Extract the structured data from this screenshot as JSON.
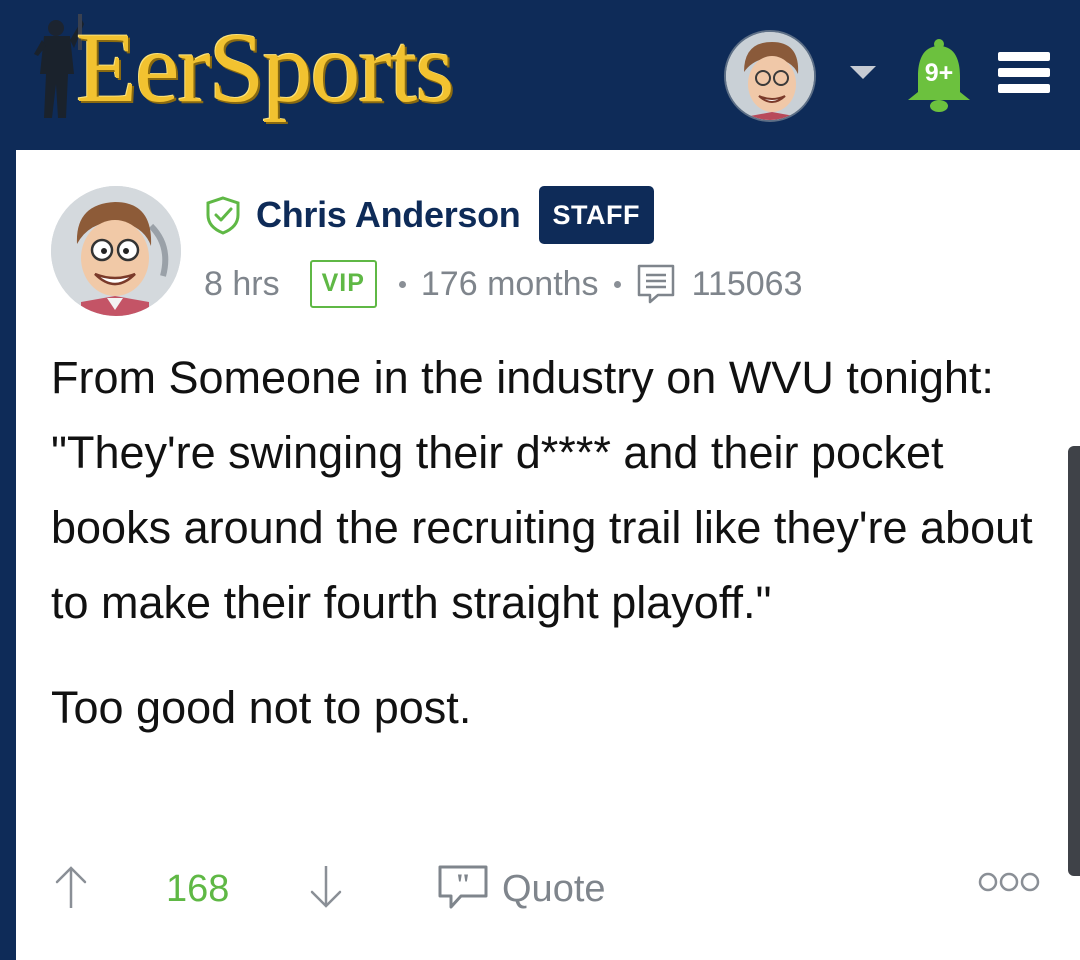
{
  "header": {
    "logo_text": "EerSports",
    "notification_count": "9+"
  },
  "post": {
    "author_name": "Chris Anderson",
    "author_role_badge": "STAFF",
    "time_ago": "8 hrs",
    "membership_badge": "VIP",
    "member_duration": "176 months",
    "message_count": "115063",
    "body_paragraph_1": "From Someone in the industry on WVU tonight: \"They're swinging their d**** and their pocket books around the recruiting trail like they're about to make their fourth straight playoff.\"",
    "body_paragraph_2": "Too good not to post.",
    "vote_score": "168",
    "quote_label": "Quote"
  },
  "colors": {
    "header_bg": "#0e2b58",
    "logo_gold": "#f2c230",
    "vip_green": "#5fb845",
    "bell_green": "#6cc13e",
    "muted_text": "#7f858c"
  },
  "icons": {
    "verified": "shield-check-icon",
    "messages": "message-icon",
    "upvote": "arrow-up-icon",
    "downvote": "arrow-down-icon",
    "quote": "quote-icon",
    "more": "more-options-icon",
    "notifications": "bell-icon",
    "menu": "hamburger-menu-icon",
    "dropdown": "caret-down-icon"
  }
}
